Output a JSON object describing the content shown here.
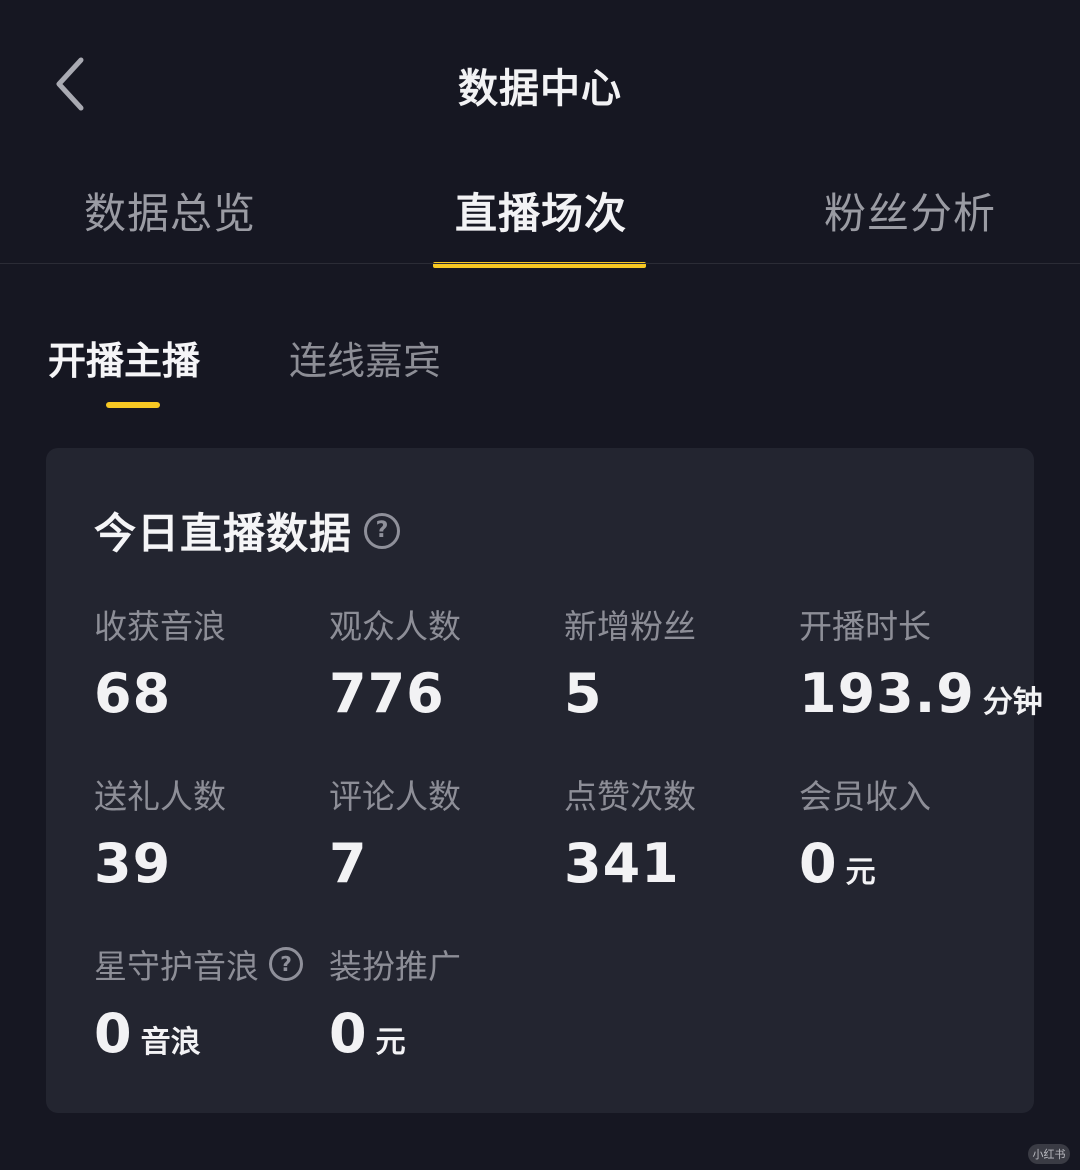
{
  "header": {
    "title": "数据中心",
    "back_icon": "chevron-left-icon"
  },
  "main_tabs": [
    {
      "label": "数据总览",
      "active": false
    },
    {
      "label": "直播场次",
      "active": true
    },
    {
      "label": "粉丝分析",
      "active": false
    }
  ],
  "sub_tabs": [
    {
      "label": "开播主播",
      "active": true
    },
    {
      "label": "连线嘉宾",
      "active": false
    }
  ],
  "card": {
    "title": "今日直播数据",
    "metrics": [
      {
        "label": "收获音浪",
        "value": "68",
        "unit": ""
      },
      {
        "label": "观众人数",
        "value": "776",
        "unit": ""
      },
      {
        "label": "新增粉丝",
        "value": "5",
        "unit": ""
      },
      {
        "label": "开播时长",
        "value": "193.9",
        "unit": "分钟"
      },
      {
        "label": "送礼人数",
        "value": "39",
        "unit": ""
      },
      {
        "label": "评论人数",
        "value": "7",
        "unit": ""
      },
      {
        "label": "点赞次数",
        "value": "341",
        "unit": ""
      },
      {
        "label": "会员收入",
        "value": "0",
        "unit": "元"
      },
      {
        "label": "星守护音浪",
        "value": "0",
        "unit": "音浪"
      },
      {
        "label": "装扮推广",
        "value": "0",
        "unit": "元"
      }
    ]
  },
  "colors": {
    "background": "#161722",
    "card": "#232530",
    "accent": "#f7c823",
    "text_primary": "#f2f2f4",
    "text_secondary": "#8d8e97"
  }
}
